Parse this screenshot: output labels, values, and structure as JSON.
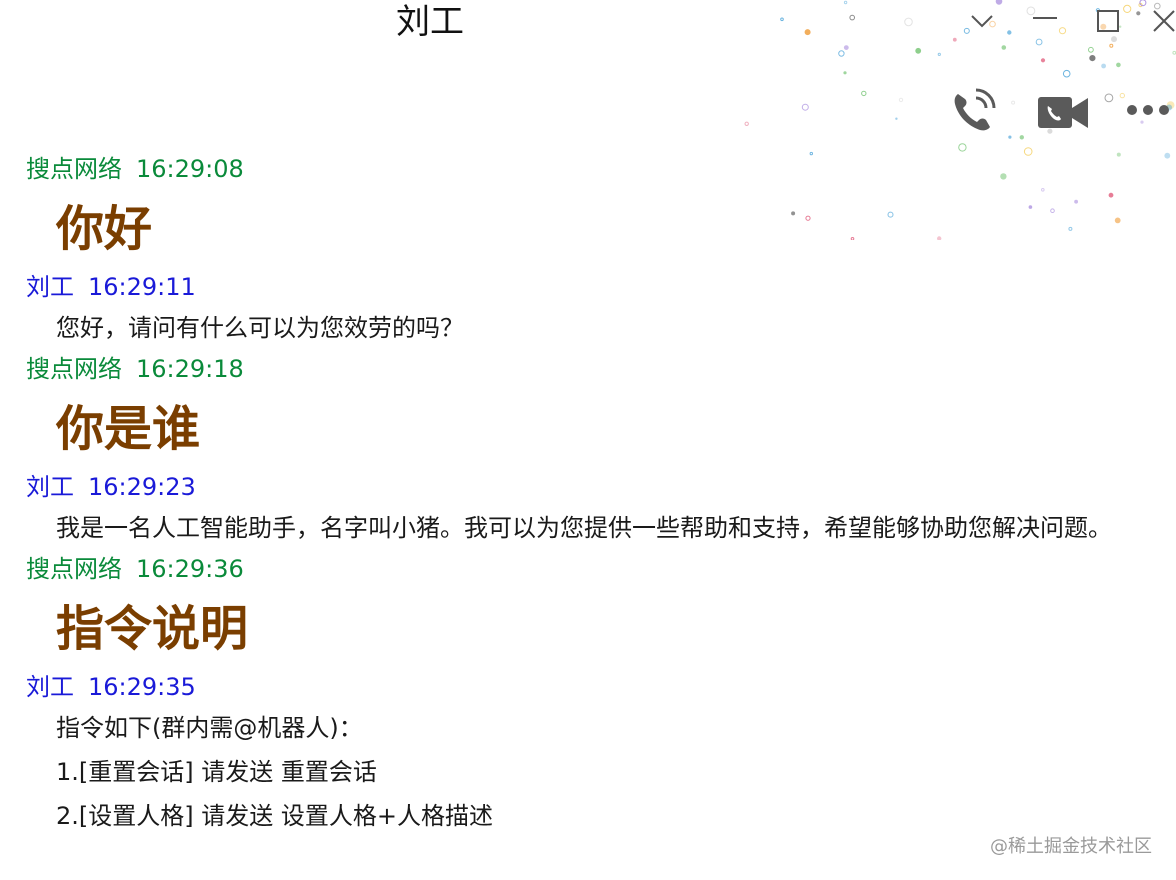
{
  "window": {
    "title": "刘工",
    "controls": [
      "chevron-down-icon",
      "minimize-icon",
      "maximize-icon",
      "close-icon"
    ]
  },
  "toolbar": {
    "icons": [
      "phone-icon",
      "video-camera-icon",
      "more-icon"
    ]
  },
  "messages": [
    {
      "sender": "搜点网络",
      "time": "16:29:08",
      "role": "bot",
      "style": "big",
      "text": "你好"
    },
    {
      "sender": "刘工",
      "time": "16:29:11",
      "role": "user",
      "style": "text",
      "text": "您好，请问有什么可以为您效劳的吗？"
    },
    {
      "sender": "搜点网络",
      "time": "16:29:18",
      "role": "bot",
      "style": "big",
      "text": "你是谁"
    },
    {
      "sender": "刘工",
      "time": "16:29:23",
      "role": "user",
      "style": "text",
      "text": "我是一名人工智能助手，名字叫小猪。我可以为您提供一些帮助和支持，希望能够协助您解决问题。"
    },
    {
      "sender": "搜点网络",
      "time": "16:29:36",
      "role": "bot",
      "style": "big",
      "text": "指令说明"
    },
    {
      "sender": "刘工",
      "time": "16:29:35",
      "role": "user",
      "style": "lines",
      "lines": [
        "指令如下(群内需@机器人)：",
        "1.[重置会话] 请发送 重置会话",
        "2.[设置人格] 请发送 设置人格+人格描述"
      ]
    }
  ],
  "colors": {
    "bot_name": "#0a8a3a",
    "user_name": "#1a1ad8",
    "big_text": "#7a3e00"
  },
  "watermark": "@稀土掘金技术社区"
}
